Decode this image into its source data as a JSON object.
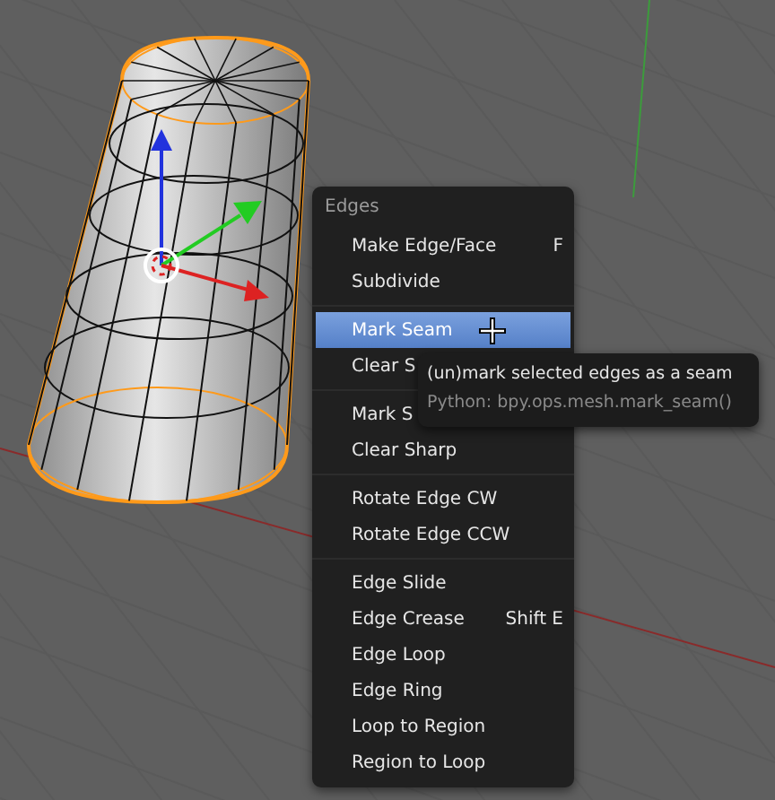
{
  "menu": {
    "title": "Edges",
    "items": [
      {
        "kind": "item",
        "label": "Make Edge/Face",
        "shortcut": "F",
        "selected": false
      },
      {
        "kind": "item",
        "label": "Subdivide",
        "selected": false
      },
      {
        "kind": "separator"
      },
      {
        "kind": "item",
        "label": "Mark Seam",
        "selected": true
      },
      {
        "kind": "item",
        "label": "Clear S",
        "selected": false
      },
      {
        "kind": "separator"
      },
      {
        "kind": "item",
        "label": "Mark S",
        "selected": false
      },
      {
        "kind": "item",
        "label": "Clear Sharp",
        "selected": false
      },
      {
        "kind": "separator"
      },
      {
        "kind": "item",
        "label": "Rotate Edge CW",
        "selected": false
      },
      {
        "kind": "item",
        "label": "Rotate Edge CCW",
        "selected": false
      },
      {
        "kind": "separator"
      },
      {
        "kind": "item",
        "label": "Edge Slide",
        "selected": false
      },
      {
        "kind": "item",
        "label": "Edge Crease",
        "shortcut": "Shift E",
        "selected": false
      },
      {
        "kind": "item",
        "label": "Edge Loop",
        "selected": false
      },
      {
        "kind": "item",
        "label": "Edge Ring",
        "selected": false
      },
      {
        "kind": "item",
        "label": "Loop to Region",
        "selected": false
      },
      {
        "kind": "item",
        "label": "Region to Loop",
        "selected": false
      }
    ]
  },
  "tooltip": {
    "description": "(un)mark selected edges as a seam",
    "python": "Python: bpy.ops.mesh.mark_seam()"
  }
}
